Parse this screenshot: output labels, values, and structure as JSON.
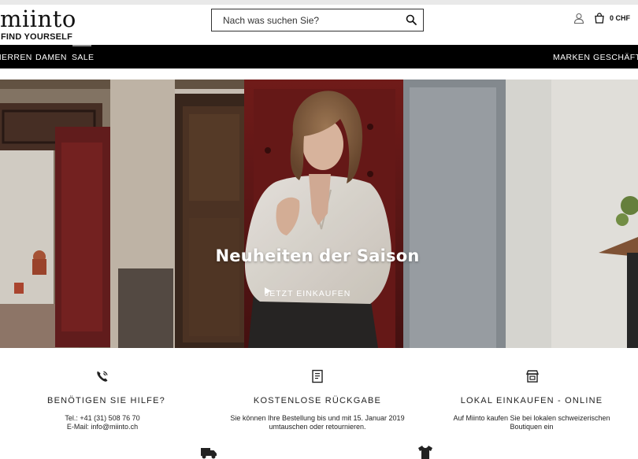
{
  "header": {
    "logo_word": "miinto",
    "logo_tagline": "FIND YOURSELF",
    "search_placeholder": "Nach was suchen Sie?",
    "cart_total": "0 CHF",
    "icons": [
      "search-icon",
      "user-icon",
      "shopping-bag-icon"
    ]
  },
  "nav": {
    "left": [
      {
        "label": "HERREN"
      },
      {
        "label": "DAMEN"
      },
      {
        "label": "SALE"
      }
    ],
    "right": [
      {
        "label": "MARKEN"
      },
      {
        "label": "GESCHÄFTE"
      }
    ]
  },
  "hero": {
    "title": "Neuheiten der Saison",
    "cta_label": "JETZT EINKAUFEN",
    "cta_icon": "play-triangle-icon"
  },
  "features": [
    {
      "icon": "phone-icon",
      "title": "BENÖTIGEN SIE HILFE?",
      "lines": [
        "Tel.: +41 (31) 508 76 70",
        "E-Mail: info@miinto.ch"
      ]
    },
    {
      "icon": "receipt-icon",
      "title": "KOSTENLOSE RÜCKGABE",
      "lines": [
        "Sie können Ihre Bestellung bis und mit 15. Januar 2019",
        "umtauschen oder retournieren."
      ]
    },
    {
      "icon": "store-icon",
      "title": "LOKAL EINKAUFEN - ONLINE",
      "lines": [
        "Auf Miinto kaufen Sie bei lokalen schweizerischen",
        "Boutiquen ein"
      ]
    }
  ],
  "bottom_icons": [
    "delivery-truck-icon",
    "tshirt-icon"
  ],
  "colors": {
    "nav_background": "#000000",
    "text": "#111111",
    "hero_overlay_text": "#ffffff"
  }
}
